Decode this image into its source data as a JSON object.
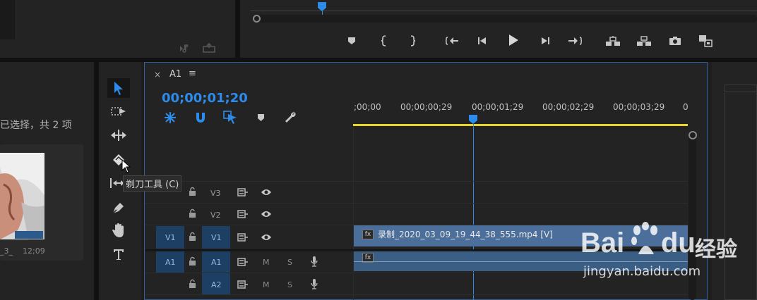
{
  "colors": {
    "accent": "#2d8ceb",
    "playhead": "#2d8ceb",
    "work_area": "#e8d629",
    "clip": "#4b6f9a",
    "track_selected": "#1d3f63"
  },
  "program_monitor": {
    "controls": [
      "marker-icon",
      "mark-in-icon",
      "mark-out-icon",
      "go-to-in-icon",
      "step-back-icon",
      "play-icon",
      "step-forward-icon",
      "go-to-out-icon",
      "lift-icon",
      "extract-icon",
      "camera-icon",
      "compare-icon"
    ]
  },
  "source_monitor": {
    "icons": [
      "drag-audio-icon",
      "export-icon"
    ]
  },
  "project": {
    "selection_text": "已选择，共 2 项",
    "clip_name": "_3_",
    "clip_duration": "12;09"
  },
  "tools": [
    {
      "name": "selection-tool",
      "icon": "arrow-icon",
      "active": true
    },
    {
      "name": "track-select-tool",
      "icon": "track-select-icon"
    },
    {
      "name": "ripple-edit-tool",
      "icon": "ripple-icon"
    },
    {
      "name": "razor-tool",
      "icon": "razor-icon"
    },
    {
      "name": "slip-tool",
      "icon": "slip-icon"
    },
    {
      "name": "pen-tool",
      "icon": "pen-icon"
    },
    {
      "name": "hand-tool",
      "icon": "hand-icon"
    },
    {
      "name": "type-tool",
      "icon": "type-icon"
    }
  ],
  "tooltip": "剃刀工具 (C)",
  "timeline": {
    "close": "×",
    "sequence_name": "A1",
    "menu": "≡",
    "timecode": "00;00;01;20",
    "ruler_labels": [
      ";00;00",
      "00;00;00;29",
      "00;00;01;29",
      "00;00;02;29",
      "00;00;03;29",
      "0"
    ],
    "playhead_position_sec": 1.667,
    "tracks": [
      {
        "source": "",
        "label": "V3",
        "type": "video"
      },
      {
        "source": "",
        "label": "V2",
        "type": "video"
      },
      {
        "source": "V1",
        "label": "V1",
        "type": "video"
      },
      {
        "source": "A1",
        "label": "A1",
        "type": "audio",
        "m": "M",
        "s": "S"
      },
      {
        "source": "",
        "label": "A2",
        "type": "audio",
        "m": "M",
        "s": "S"
      }
    ],
    "clip_label": "录制_2020_03_09_19_44_38_555.mp4 [V]",
    "fx_label": "fx"
  },
  "watermark": {
    "brand": "Bai",
    "brand_suffix": "du",
    "product": "经验",
    "url": "jingyan.baidu.com"
  }
}
